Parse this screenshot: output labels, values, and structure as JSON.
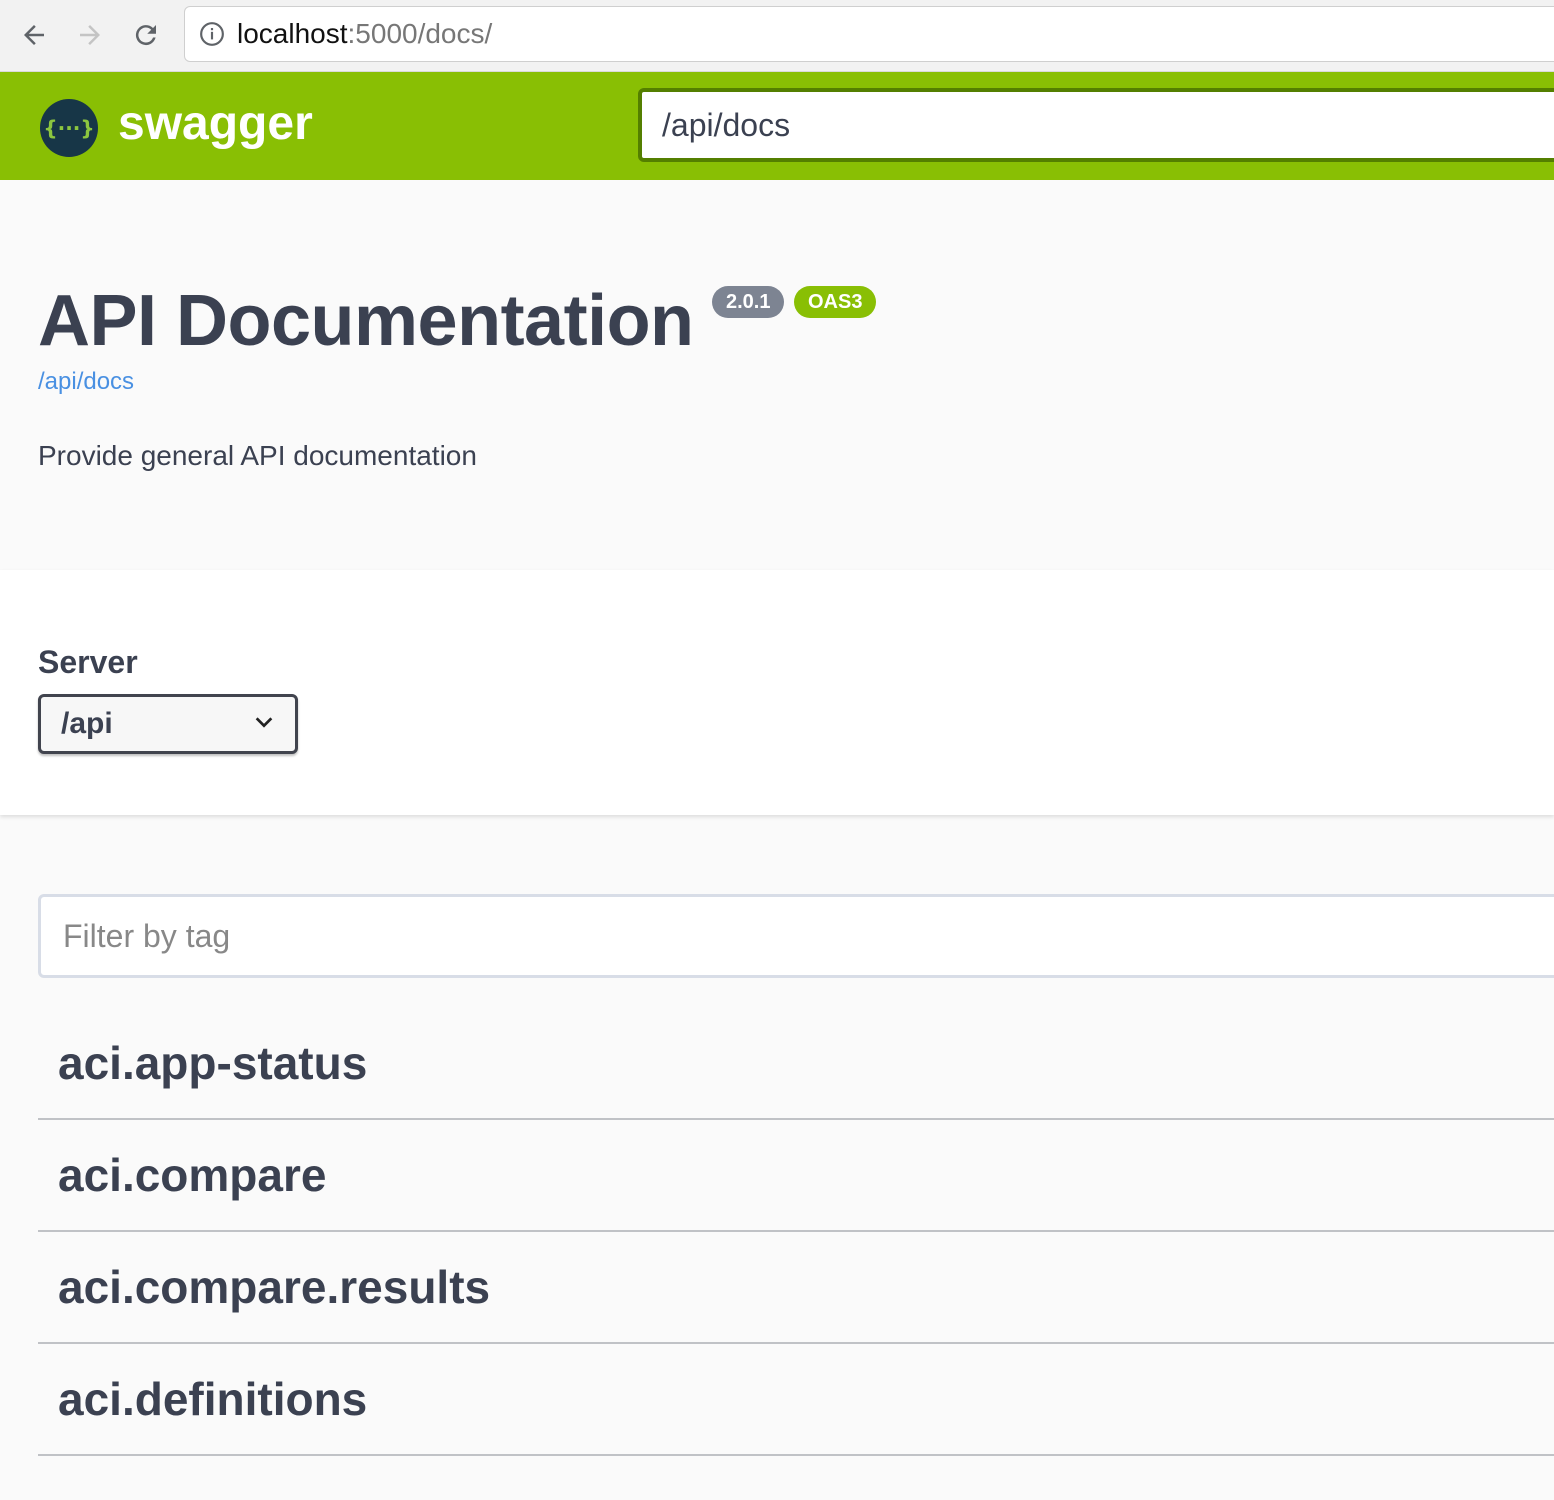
{
  "browser": {
    "url_host": "localhost",
    "url_rest": ":5000/docs/"
  },
  "topbar": {
    "logo_mark": "{···}",
    "logo_text": "swagger",
    "spec_url": "/api/docs"
  },
  "info": {
    "title": "API Documentation",
    "version_badge": "2.0.1",
    "oas_badge": "OAS3",
    "spec_link": "/api/docs",
    "description": "Provide general API documentation"
  },
  "servers": {
    "label": "Server",
    "selected": "/api"
  },
  "filter": {
    "placeholder": "Filter by tag"
  },
  "tags": [
    "aci.app-status",
    "aci.compare",
    "aci.compare.results",
    "aci.definitions"
  ],
  "colors": {
    "topbar": "#89bf04",
    "spec_input_border": "#547f00",
    "link": "#4990e2",
    "version_badge": "#7d8492",
    "oas_badge": "#89bf04",
    "text": "#3b4151"
  }
}
